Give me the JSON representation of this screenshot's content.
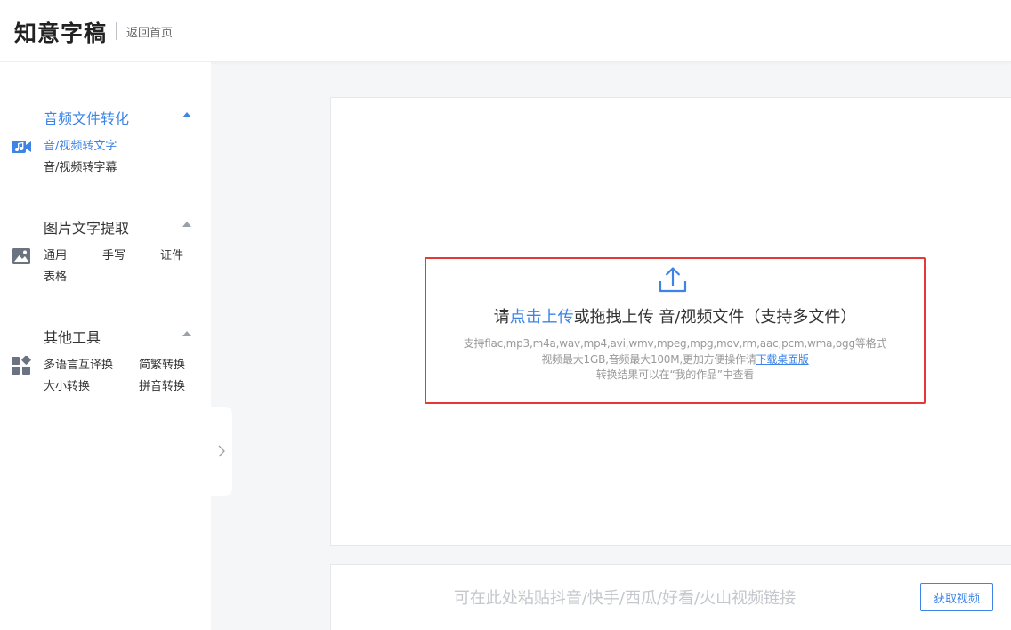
{
  "header": {
    "logo": "知意字稿",
    "back_label": "返回首页"
  },
  "sidebar": {
    "sections": [
      {
        "title": "音频文件转化",
        "icon": "video-music-icon",
        "items": [
          "音/视频转文字",
          "音/视频转字幕"
        ]
      },
      {
        "title": "图片文字提取",
        "icon": "image-icon",
        "items": [
          "通用",
          "手写",
          "证件",
          "表格"
        ]
      },
      {
        "title": "其他工具",
        "icon": "apps-grid-icon",
        "items": [
          "多语言互译换",
          "简繁转换",
          "大小转换",
          "拼音转换"
        ]
      }
    ]
  },
  "upload": {
    "prefix": "请",
    "click_link": "点击上传",
    "suffix": "或拖拽上传 音/视频文件（支持多文件）",
    "formats": "支持flac,mp3,m4a,wav,mp4,avi,wmv,mpeg,mpg,mov,rm,aac,pcm,wma,ogg等格式",
    "limits_prefix": "视频最大1GB,音频最大100M,更加方便操作请",
    "download_link": "下载桌面版",
    "result_note": "转换结果可以在“我的作品”中查看"
  },
  "link_bar": {
    "placeholder": "可在此处粘贴抖音/快手/西瓜/好看/火山视频链接",
    "fetch_label": "获取视频"
  },
  "colors": {
    "accent": "#3d84e6",
    "highlight_border": "#e53935"
  }
}
